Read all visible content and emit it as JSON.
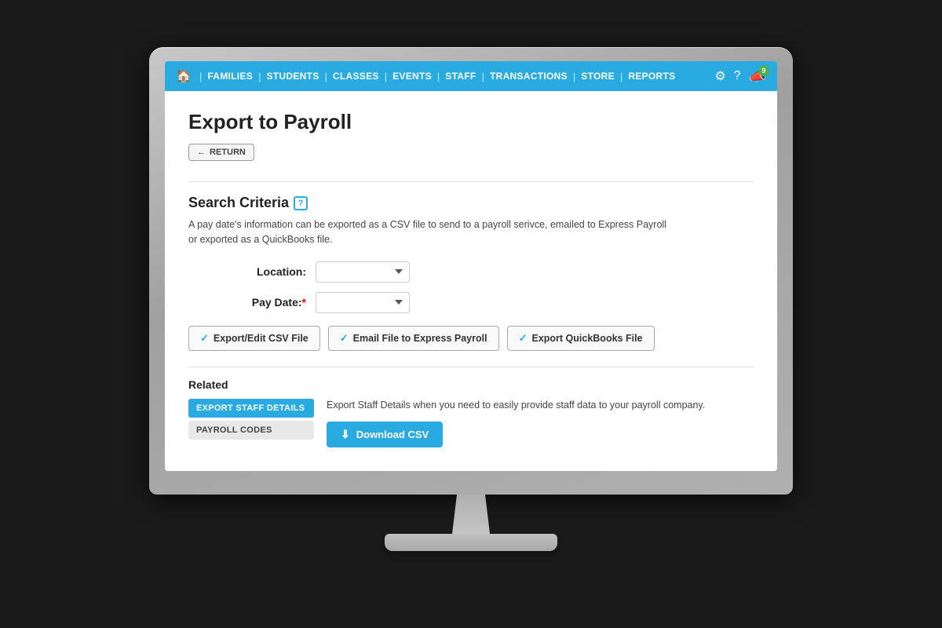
{
  "navbar": {
    "home_icon": "🏠",
    "links": [
      {
        "label": "FAMILIES",
        "id": "families"
      },
      {
        "label": "STUDENTS",
        "id": "students"
      },
      {
        "label": "CLASSES",
        "id": "classes"
      },
      {
        "label": "EVENTS",
        "id": "events"
      },
      {
        "label": "STAFF",
        "id": "staff"
      },
      {
        "label": "TRANSACTIONS",
        "id": "transactions"
      },
      {
        "label": "STORE",
        "id": "store"
      },
      {
        "label": "REPORTS",
        "id": "reports"
      }
    ],
    "notification_count": "9"
  },
  "page": {
    "title": "Export to Payroll",
    "return_label": "RETURN",
    "section_title": "Search Criteria",
    "description": "A pay date's information can be exported as a CSV file to send to a payroll serivce, emailed to Express Payroll or exported as a QuickBooks file.",
    "location_label": "Location:",
    "pay_date_label": "Pay Date:",
    "buttons": {
      "export_csv": "Export/Edit CSV File",
      "email_express": "Email File to Express Payroll",
      "export_quickbooks": "Export QuickBooks File"
    },
    "related_title": "Related",
    "related_links": [
      {
        "label": "EXPORT STAFF DETAILS",
        "active": true
      },
      {
        "label": "PAYROLL CODES",
        "active": false
      }
    ],
    "related_desc": "Export Staff Details when you need to easily provide staff data to your payroll company.",
    "download_label": "Download CSV"
  }
}
